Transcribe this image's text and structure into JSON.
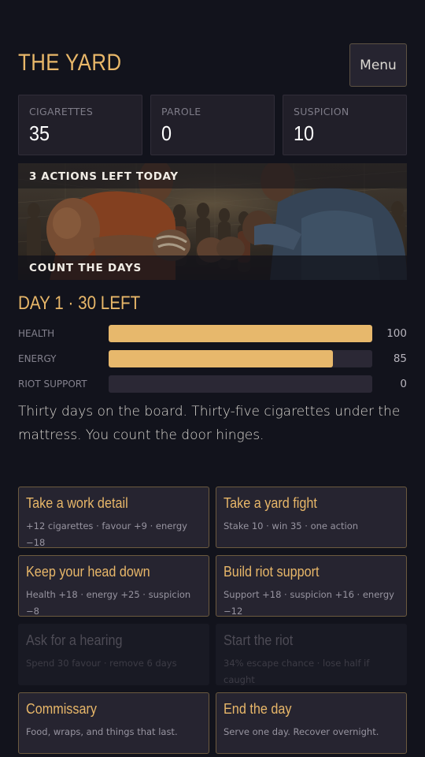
{
  "header": {
    "title": "THE YARD",
    "menu_label": "Menu"
  },
  "stats": [
    {
      "label": "CIGARETTES",
      "value": "35"
    },
    {
      "label": "PAROLE",
      "value": "0"
    },
    {
      "label": "SUSPICION",
      "value": "10"
    }
  ],
  "banner": {
    "top_text": "3 ACTIONS LEFT TODAY",
    "bottom_text": "COUNT THE DAYS"
  },
  "day": {
    "title": "DAY 1 · 30 LEFT"
  },
  "bars": [
    {
      "label": "HEALTH",
      "value": "100",
      "fill": 1.0
    },
    {
      "label": "ENERGY",
      "value": "85",
      "fill": 0.85
    },
    {
      "label": "RIOT SUPPORT",
      "value": "0",
      "fill": 0.0
    }
  ],
  "narrative": "Thirty days on the board. Thirty-five cigarettes under the mattress. You count the door hinges.",
  "actions": [
    {
      "title": "Take a work detail",
      "desc": "+12 cigarettes · favour +9 · energy −18",
      "enabled": true
    },
    {
      "title": "Take a yard fight",
      "desc": "Stake 10 · win 35 · one action",
      "enabled": true
    },
    {
      "title": "Keep your head down",
      "desc": "Health +18 · energy +25 · suspicion −8",
      "enabled": true
    },
    {
      "title": "Build riot support",
      "desc": "Support +18 · suspicion +16 · energy −12",
      "enabled": true
    },
    {
      "title": "Ask for a hearing",
      "desc": "Spend 30 favour · remove 6 days",
      "enabled": false
    },
    {
      "title": "Start the riot",
      "desc": "34% escape chance · lose half if caught",
      "enabled": false
    },
    {
      "title": "Commissary",
      "desc": "Food, wraps, and things that last.",
      "enabled": true
    },
    {
      "title": "End the day",
      "desc": "Serve one day. Recover overnight.",
      "enabled": true
    }
  ],
  "colors": {
    "accent": "#e8b769",
    "background": "#12131c",
    "card": "#262430",
    "border": "#6c5a3f"
  }
}
